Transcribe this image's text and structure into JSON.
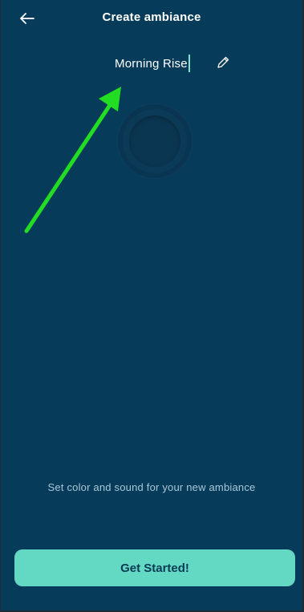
{
  "header": {
    "title": "Create ambiance",
    "back_icon": "arrow-left-icon"
  },
  "name_field": {
    "value": "Morning Rise",
    "edit_icon": "pencil-icon"
  },
  "preview": {
    "icon": "circle-orb-icon"
  },
  "annotation": {
    "icon": "green-arrow-annotation",
    "color": "#22dd22"
  },
  "hint_text": "Set color and sound for your new ambiance",
  "cta": {
    "label": "Get Started!"
  },
  "colors": {
    "background": "#073b5a",
    "accent": "#63d9c4",
    "text": "#ffffff",
    "muted_text": "#a9c7d8"
  }
}
